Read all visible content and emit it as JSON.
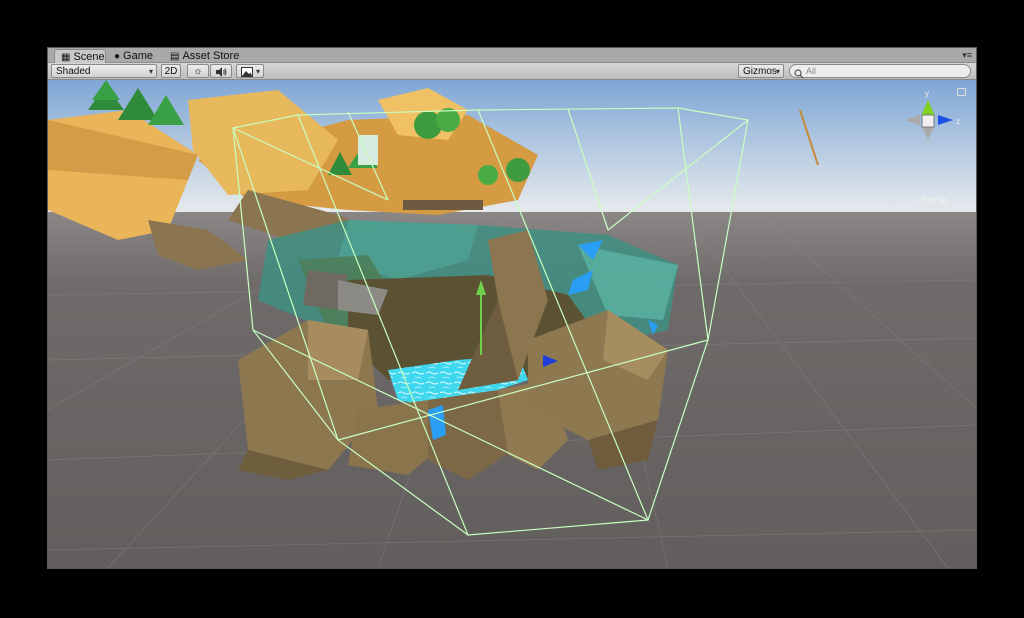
{
  "tabs": [
    {
      "label": "Scene",
      "icon": "scene-icon",
      "active": true
    },
    {
      "label": "Game",
      "icon": "game-controller-icon",
      "active": false
    },
    {
      "label": "Asset Store",
      "icon": "asset-store-icon",
      "active": false
    }
  ],
  "toolbar": {
    "draw_mode": "Shaded",
    "toggle_2d": "2D",
    "lighting_icon": "sun-icon",
    "audio_icon": "speaker-icon",
    "effects_icon": "image-icon",
    "gizmos_label": "Gizmos",
    "search_placeholder": "All"
  },
  "scene_gizmo": {
    "projection_label": "Persp",
    "y_label": "y",
    "z_label": "z",
    "colors": {
      "y_axis": "#7ed321",
      "z_axis": "#1e50e6",
      "x_axis": "#bbbbbb"
    }
  },
  "colors": {
    "sky_top": "#8eb3dc",
    "sky_bottom": "#e5e9ec",
    "ground": "#6a6665",
    "bounds_wireframe": "#c8ffc0",
    "rock": "#8b7650",
    "cliff_yellow": "#e8b75a",
    "water": "#40e0f0",
    "selection_blue": "#2a9df4"
  }
}
